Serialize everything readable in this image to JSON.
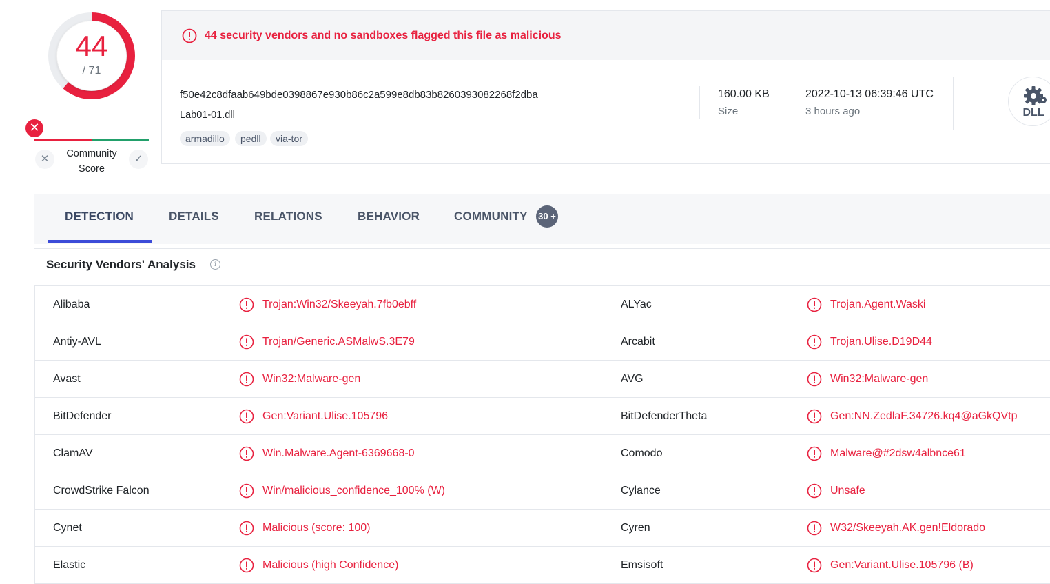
{
  "score": {
    "detections": "44",
    "total": "/ 71"
  },
  "community": {
    "label_line1": "Community",
    "label_line2": "Score"
  },
  "alert": {
    "text": "44 security vendors and no sandboxes flagged this file as malicious"
  },
  "file": {
    "hash": "f50e42c8dfaab649bde0398867e930b86c2a599e8db83b8260393082268f2dba",
    "name": "Lab01-01.dll",
    "tags": [
      "armadillo",
      "pedll",
      "via-tor"
    ],
    "size_value": "160.00 KB",
    "size_label": "Size",
    "date_value": "2022-10-13 06:39:46 UTC",
    "date_relative": "3 hours ago",
    "type_icon_label": "DLL"
  },
  "tabs": [
    {
      "label": "DETECTION"
    },
    {
      "label": "DETAILS"
    },
    {
      "label": "RELATIONS"
    },
    {
      "label": "BEHAVIOR"
    },
    {
      "label": "COMMUNITY"
    }
  ],
  "community_badge": "30 +",
  "section": {
    "title": "Security Vendors' Analysis"
  },
  "vendors": [
    {
      "left_name": "Alibaba",
      "left_result": "Trojan:Win32/Skeeyah.7fb0ebff",
      "right_name": "ALYac",
      "right_result": "Trojan.Agent.Waski"
    },
    {
      "left_name": "Antiy-AVL",
      "left_result": "Trojan/Generic.ASMalwS.3E79",
      "right_name": "Arcabit",
      "right_result": "Trojan.Ulise.D19D44"
    },
    {
      "left_name": "Avast",
      "left_result": "Win32:Malware-gen",
      "right_name": "AVG",
      "right_result": "Win32:Malware-gen"
    },
    {
      "left_name": "BitDefender",
      "left_result": "Gen:Variant.Ulise.105796",
      "right_name": "BitDefenderTheta",
      "right_result": "Gen:NN.ZedlaF.34726.kq4@aGkQVtp"
    },
    {
      "left_name": "ClamAV",
      "left_result": "Win.Malware.Agent-6369668-0",
      "right_name": "Comodo",
      "right_result": "Malware@#2dsw4albnce61"
    },
    {
      "left_name": "CrowdStrike Falcon",
      "left_result": "Win/malicious_confidence_100% (W)",
      "right_name": "Cylance",
      "right_result": "Unsafe"
    },
    {
      "left_name": "Cynet",
      "left_result": "Malicious (score: 100)",
      "right_name": "Cyren",
      "right_result": "W32/Skeeyah.AK.gen!Eldorado"
    },
    {
      "left_name": "Elastic",
      "left_result": "Malicious (high Confidence)",
      "right_name": "Emsisoft",
      "right_result": "Gen:Variant.Ulise.105796 (B)"
    }
  ],
  "colors": {
    "malicious": "#e8213f",
    "tab_underline": "#3b4bd8",
    "harmless": "#22a06b"
  },
  "icons": {
    "alert": "exclamation-circle-icon",
    "file_type": "gear-dll-icon",
    "info": "info-icon",
    "vote_down": "close-icon",
    "vote_up": "check-icon"
  }
}
